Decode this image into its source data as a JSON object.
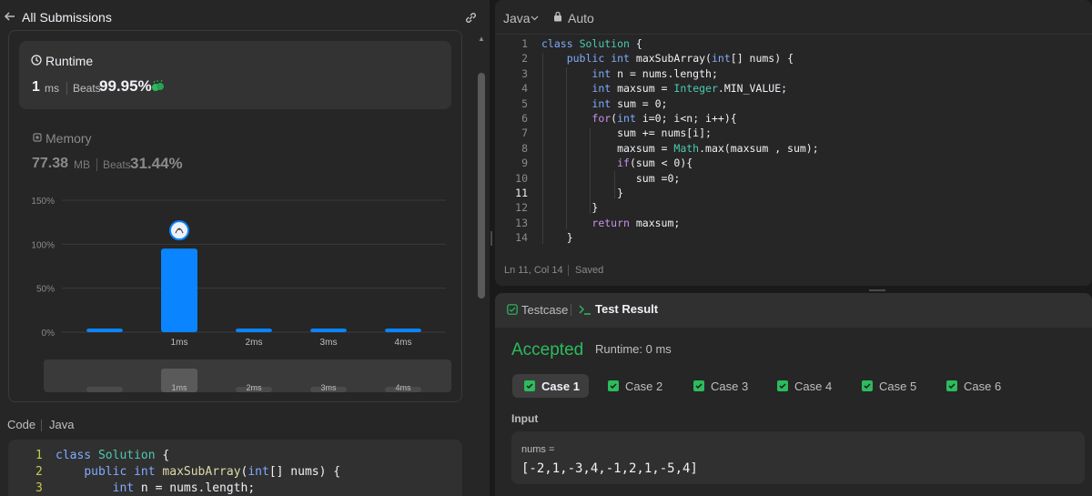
{
  "left_header": {
    "title": "All Submissions",
    "back_icon": "arrow-left-icon",
    "link_icon": "link-icon"
  },
  "runtime": {
    "label": "Runtime",
    "value": "1",
    "unit": "ms",
    "beats_label": "Beats",
    "beats": "99.95%"
  },
  "memory": {
    "label": "Memory",
    "value": "77.38",
    "unit": "MB",
    "beats_label": "Beats",
    "beats": "31.44%"
  },
  "chart_data": {
    "type": "bar",
    "categories": [
      "",
      "1ms",
      "2ms",
      "3ms",
      "4ms"
    ],
    "values": [
      2,
      95,
      2,
      2,
      2
    ],
    "ylim": [
      0,
      150
    ],
    "yticks": [
      "150%",
      "100%",
      "50%",
      "0%"
    ],
    "highlight_index": 1,
    "bar_color": "#0a84ff",
    "grid": true,
    "minimap_labels": [
      "1ms",
      "2ms",
      "3ms",
      "4ms"
    ]
  },
  "code_section": {
    "label": "Code",
    "lang": "Java",
    "lines": [
      {
        "n": "1",
        "code": "class Solution {"
      },
      {
        "n": "2",
        "code": "    public int maxSubArray(int[] nums) {"
      },
      {
        "n": "3",
        "code": "        int n = nums.length;"
      }
    ]
  },
  "editor": {
    "language": "Java",
    "mode": "Auto",
    "status_position": "Ln 11, Col 14",
    "status_saved": "Saved",
    "active_line": 11,
    "lines": [
      {
        "n": "1",
        "code": "class Solution {"
      },
      {
        "n": "2",
        "code": "    public int maxSubArray(int[] nums) {"
      },
      {
        "n": "3",
        "code": "        int n = nums.length;"
      },
      {
        "n": "4",
        "code": "        int maxsum = Integer.MIN_VALUE;"
      },
      {
        "n": "5",
        "code": "        int sum = 0;"
      },
      {
        "n": "6",
        "code": "        for(int i=0; i<n; i++){"
      },
      {
        "n": "7",
        "code": "            sum += nums[i];"
      },
      {
        "n": "8",
        "code": "            maxsum = Math.max(maxsum , sum);"
      },
      {
        "n": "9",
        "code": "            if(sum < 0){"
      },
      {
        "n": "10",
        "code": "               sum =0;"
      },
      {
        "n": "11",
        "code": "            }"
      },
      {
        "n": "12",
        "code": "        }"
      },
      {
        "n": "13",
        "code": "        return maxsum;"
      },
      {
        "n": "14",
        "code": "    }"
      }
    ]
  },
  "tests": {
    "tab_testcase": "Testcase",
    "tab_result": "Test Result",
    "status": "Accepted",
    "runtime": "Runtime: 0 ms",
    "cases": [
      "Case 1",
      "Case 2",
      "Case 3",
      "Case 4",
      "Case 5",
      "Case 6"
    ],
    "active_case": 0,
    "input_label": "Input",
    "input_var": "nums =",
    "input_value": "[-2,1,-3,4,-1,2,1,-5,4]"
  },
  "colors": {
    "accent_green": "#2cbb5d",
    "bar_blue": "#0a84ff",
    "panel": "#262626",
    "background": "#1a1a1a"
  }
}
